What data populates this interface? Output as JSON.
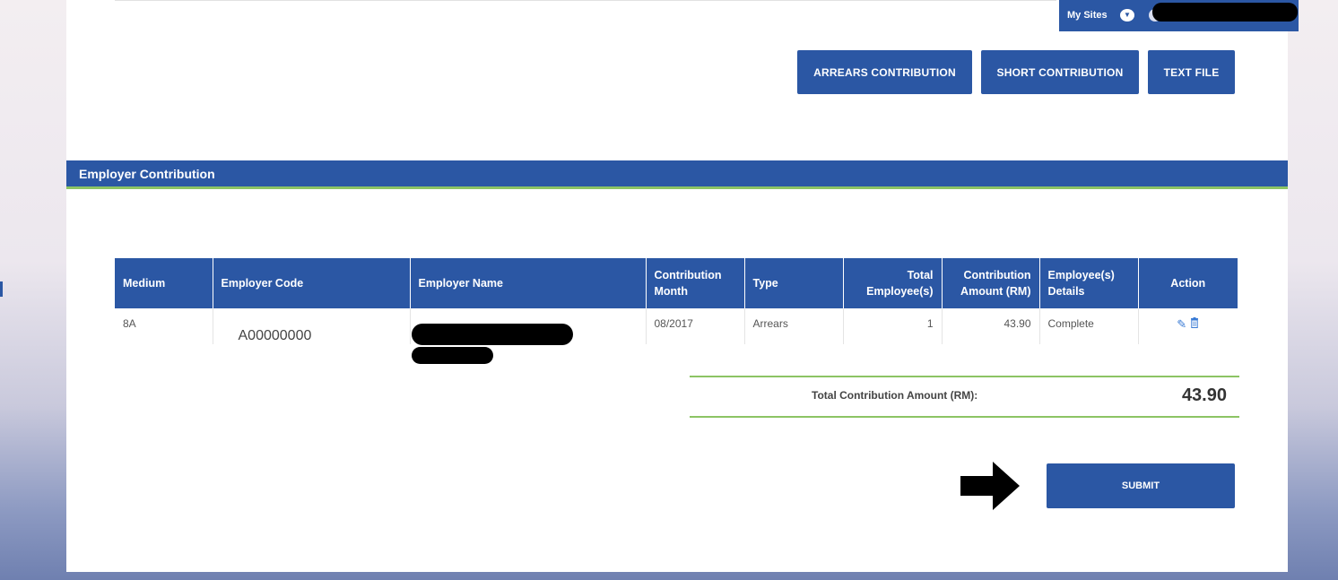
{
  "header": {
    "my_sites_label": "My Sites",
    "dropdown_icon": "chevron-down-icon"
  },
  "toolbar": {
    "buttons": [
      {
        "label": "ARREARS CONTRIBUTION"
      },
      {
        "label": "SHORT CONTRIBUTION"
      },
      {
        "label": "TEXT FILE"
      }
    ]
  },
  "section": {
    "title": "Employer Contribution"
  },
  "table": {
    "columns": [
      "Medium",
      "Employer Code",
      "Employer Name",
      "Contribution Month",
      "Type",
      "Total Employee(s)",
      "Contribution Amount (RM)",
      "Employee(s) Details",
      "Action"
    ],
    "rows": [
      {
        "medium": "8A",
        "employer_code": "A00000000",
        "employer_name": "",
        "contribution_month": "08/2017",
        "type": "Arrears",
        "total_employees": "1",
        "contribution_amount": "43.90",
        "details": "Complete"
      }
    ]
  },
  "total": {
    "label": "Total Contribution Amount (RM):",
    "value": "43.90"
  },
  "submit": {
    "label": "SUBMIT"
  },
  "colors": {
    "primary": "#2b57a4",
    "accent_green": "#8cc464",
    "icon_blue": "#3a7bd5"
  }
}
